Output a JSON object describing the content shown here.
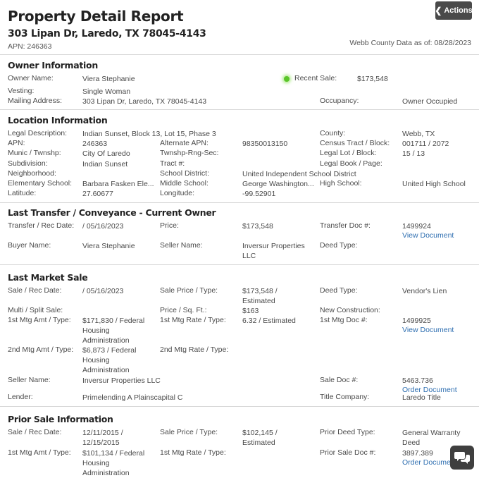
{
  "header": {
    "title": "Property Detail Report",
    "address": "303 Lipan Dr, Laredo, TX 78045-4143",
    "apn": "APN: 246363",
    "as_of": "Webb County Data as of: 08/28/2023",
    "actions_label": "Actions"
  },
  "owner": {
    "title": "Owner Information",
    "rows": [
      {
        "label": "Owner Name:",
        "value": "Viera Stephanie"
      },
      {
        "label": "Vesting:",
        "value": "Single Woman"
      },
      {
        "label": "Mailing Address:",
        "value": "303 Lipan Dr, Laredo, TX 78045-4143"
      }
    ],
    "recent_sale_label": "Recent Sale:",
    "recent_sale_value": "$173,548",
    "occupancy_label": "Occupancy:",
    "occupancy_value": "Owner Occupied"
  },
  "location": {
    "title": "Location Information",
    "col1": [
      {
        "label": "Legal Description:",
        "value": "Indian Sunset, Block 13, Lot 15, Phase 3"
      },
      {
        "label": "APN:",
        "value": "246363"
      },
      {
        "label": "Munic / Twnshp:",
        "value": "City Of Laredo"
      },
      {
        "label": "Subdivision:",
        "value": "Indian Sunset"
      },
      {
        "label": "Neighborhood:",
        "value": ""
      },
      {
        "label": "Elementary School:",
        "value": "Barbara Fasken Ele..."
      },
      {
        "label": "Latitude:",
        "value": "27.60677"
      }
    ],
    "col2": [
      {
        "label": "Alternate APN:",
        "value": "98350013150"
      },
      {
        "label": "Twnshp-Rng-Sec:",
        "value": ""
      },
      {
        "label": "Tract #:",
        "value": ""
      },
      {
        "label": "School District:",
        "value": "United Independent School District"
      },
      {
        "label": "Middle School:",
        "value": "George Washington..."
      },
      {
        "label": "Longitude:",
        "value": "-99.52901"
      }
    ],
    "col3": [
      {
        "label": "County:",
        "value": "Webb, TX"
      },
      {
        "label": "Census Tract / Block:",
        "value": "001711 / 2072"
      },
      {
        "label": "Legal Lot / Block:",
        "value": "15 / 13"
      },
      {
        "label": "Legal Book / Page:",
        "value": ""
      },
      {
        "label": "High School:",
        "value": "United High School"
      }
    ]
  },
  "transfer": {
    "title": "Last Transfer / Conveyance - Current Owner",
    "transfer_date_label": "Transfer / Rec Date:",
    "transfer_date_value": "/ 05/16/2023",
    "price_label": "Price:",
    "price_value": "$173,548",
    "doc_label": "Transfer Doc #:",
    "doc_value": "1499924",
    "view_document": "View Document",
    "buyer_label": "Buyer Name:",
    "buyer_value": "Viera Stephanie",
    "seller_label": "Seller Name:",
    "seller_value": "Inversur Properties LLC",
    "deed_label": "Deed Type:",
    "deed_value": ""
  },
  "market": {
    "title": "Last Market Sale",
    "sale_date_label": "Sale / Rec Date:",
    "sale_date_value": "/ 05/16/2023",
    "sale_price_label": "Sale Price / Type:",
    "sale_price_value": "$173,548 / Estimated",
    "deed_label": "Deed Type:",
    "deed_value": "Vendor's Lien",
    "multi_label": "Multi / Split Sale:",
    "ppsf_label": "Price / Sq. Ft.:",
    "ppsf_value": "$163",
    "new_const_label": "New Construction:",
    "mtg1_amt_label": "1st Mtg Amt / Type:",
    "mtg1_amt_value": "$171,830 / Federal Housing Administration",
    "mtg1_rate_label": "1st Mtg Rate / Type:",
    "mtg1_rate_value": "6.32 / Estimated",
    "mtg1_doc_label": "1st Mtg Doc #:",
    "mtg1_doc_value": "1499925",
    "view_document": "View Document",
    "mtg2_amt_label": "2nd Mtg Amt / Type:",
    "mtg2_amt_value": "$6,873 / Federal Housing Administration",
    "mtg2_rate_label": "2nd Mtg Rate / Type:",
    "seller_label": "Seller Name:",
    "seller_value": "Inversur Properties LLC",
    "sale_doc_label": "Sale Doc #:",
    "sale_doc_value": "5463.736",
    "order_document": "Order Document",
    "lender_label": "Lender:",
    "lender_value": "Primelending A Plainscapital C",
    "title_co_label": "Title Company:",
    "title_co_value": "Laredo Title"
  },
  "prior": {
    "title": "Prior Sale Information",
    "sale_date_label": "Sale / Rec Date:",
    "sale_date_value": "12/11/2015 / 12/15/2015",
    "sale_price_label": "Sale Price / Type:",
    "sale_price_value": "$102,145 / Estimated",
    "deed_label": "Prior Deed Type:",
    "deed_value": "General Warranty Deed",
    "mtg1_amt_label": "1st Mtg Amt / Type:",
    "mtg1_amt_value": "$101,134 / Federal Housing Administration",
    "mtg1_rate_label": "1st Mtg Rate / Type:",
    "doc_label": "Prior Sale Doc #:",
    "doc_value": "3897.389",
    "order_document": "Order Document"
  }
}
